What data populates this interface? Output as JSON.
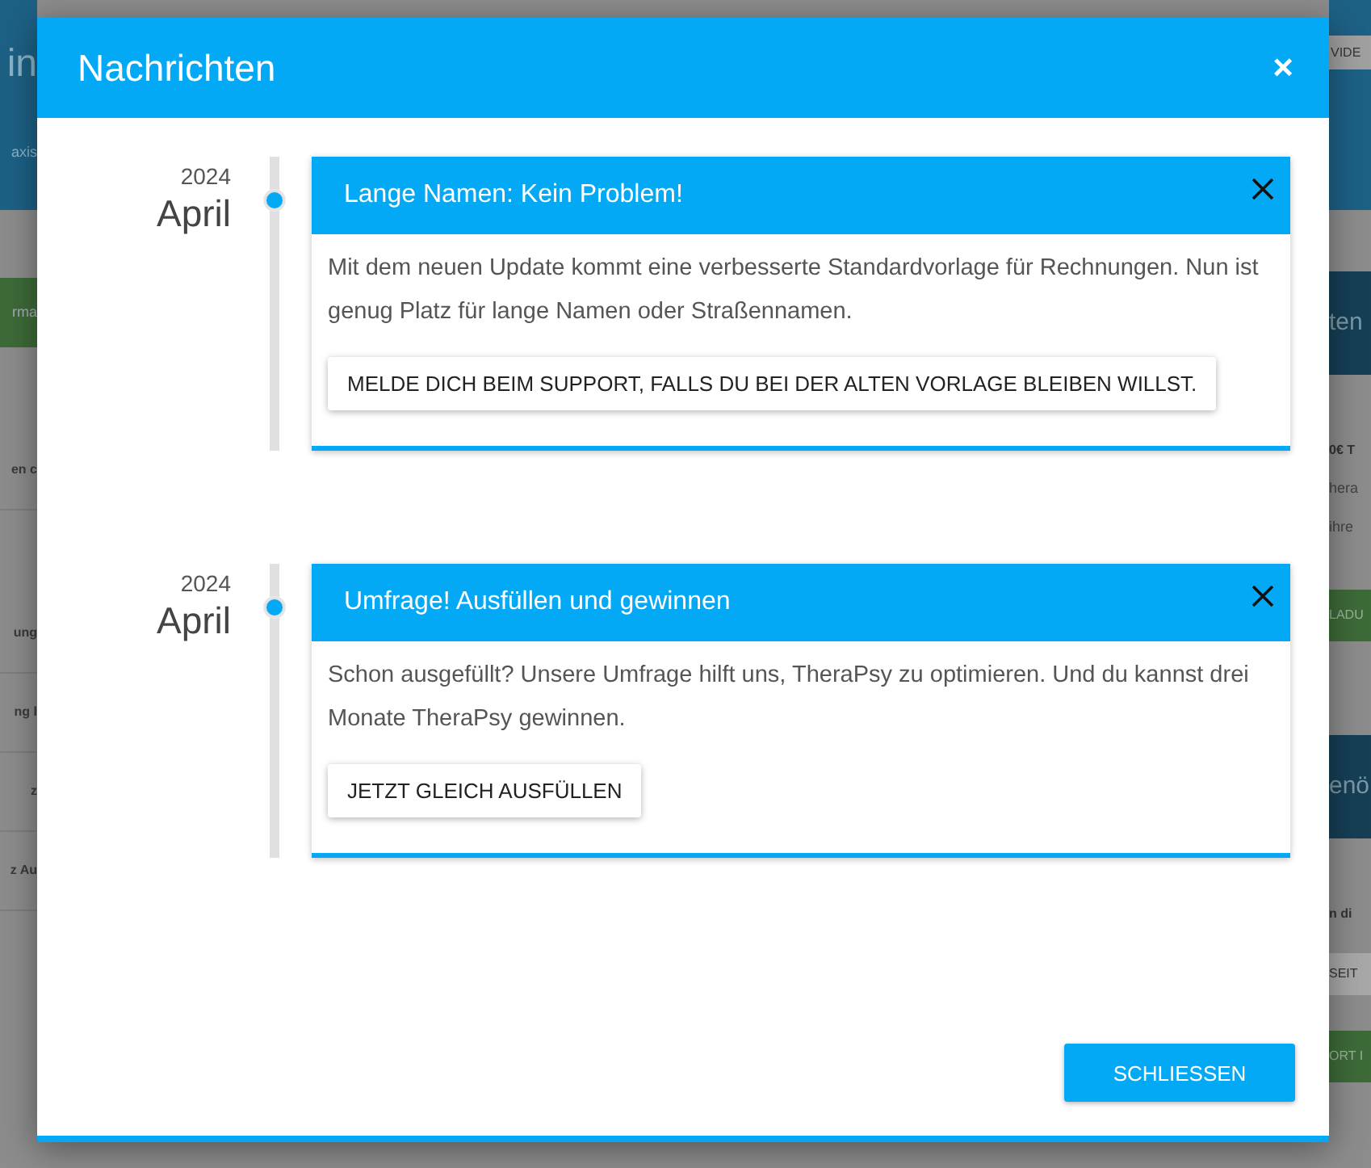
{
  "background": {
    "left": [
      {
        "kind": "header-title",
        "text": "in"
      },
      {
        "kind": "header-text",
        "text": "axis"
      },
      {
        "kind": "green-button",
        "text": "rma"
      },
      {
        "kind": "row",
        "text": "en c"
      },
      {
        "kind": "row",
        "text": "ung"
      },
      {
        "kind": "row",
        "text": "ng l"
      },
      {
        "kind": "row",
        "text": "z"
      },
      {
        "kind": "row",
        "text": "z Au"
      }
    ],
    "right": [
      {
        "kind": "header-button",
        "text": "VIDE"
      },
      {
        "kind": "panel-title",
        "text": "ten"
      },
      {
        "kind": "bold",
        "text": "0€ T"
      },
      {
        "kind": "text",
        "text": "hera"
      },
      {
        "kind": "text",
        "text": "ihre"
      },
      {
        "kind": "green-button",
        "text": "LADU"
      },
      {
        "kind": "panel-title",
        "text": "enö"
      },
      {
        "kind": "bold",
        "text": "n di"
      },
      {
        "kind": "grey-button",
        "text": "SEIT"
      },
      {
        "kind": "green-button",
        "text": "ORT I"
      }
    ]
  },
  "dialog": {
    "title": "Nachrichten",
    "close": "×",
    "entries": [
      {
        "year": "2024",
        "month": "April",
        "title": "Lange Namen: Kein Problem!",
        "text": "Mit dem neuen Update kommt eine verbesserte Standardvorlage für Rechnungen. Nun ist genug Platz für lange Namen oder Straßennamen.",
        "action": "MELDE DICH BEIM SUPPORT, FALLS DU BEI DER ALTEN VORLAGE BLEIBEN WILLST."
      },
      {
        "year": "2024",
        "month": "April",
        "title": "Umfrage! Ausfüllen und gewinnen",
        "text": "Schon ausgefüllt? Unsere Umfrage hilft uns, TheraPsy zu optimieren. Und du kannst drei Monate TheraPsy gewinnen.",
        "action": "JETZT GLEICH AUSFÜLLEN"
      }
    ],
    "close_button": "SCHLIESSEN"
  }
}
